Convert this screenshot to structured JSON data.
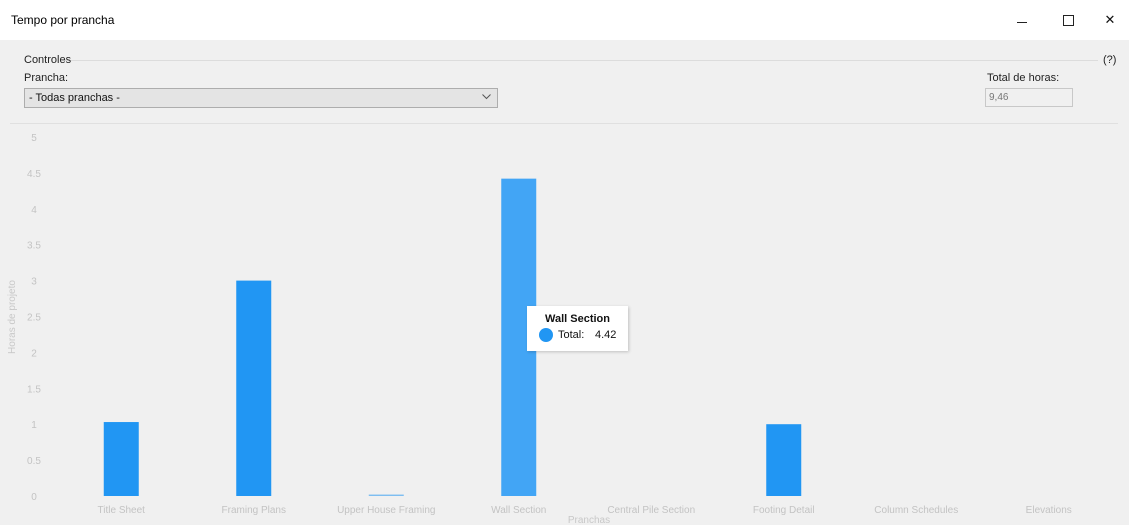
{
  "window": {
    "title": "Tempo por prancha",
    "buttons": {
      "minimize": "minimize",
      "maximize": "maximize",
      "close": "✕"
    }
  },
  "controls": {
    "legend": "Controles",
    "help": "(?)",
    "prancha_label": "Prancha:",
    "prancha_value": "- Todas pranchas -",
    "total_label": "Total de horas:",
    "total_value": "9,46"
  },
  "colors": {
    "bar": "#2196f3",
    "bar_highlight": "#42a5f5",
    "tooltip_dot": "#2196f3"
  },
  "tooltip": {
    "title": "Wall Section",
    "label": "Total:",
    "value": "4.42"
  },
  "chart_data": {
    "type": "bar",
    "categories": [
      "Title Sheet",
      "Framing Plans",
      "Upper House Framing",
      "Wall Section",
      "Central Pile Section",
      "Footing Detail",
      "Column Schedules",
      "Elevations"
    ],
    "series": [
      {
        "values": [
          1.03,
          3.0,
          0.02,
          4.42,
          0,
          1.0,
          0,
          0
        ]
      }
    ],
    "highlighted_index": 3,
    "xlabel": "Pranchas",
    "ylabel": "Horas de projeto",
    "ylim": [
      0,
      5
    ],
    "yticks": [
      "0",
      "0.5",
      "1",
      "1.5",
      "2",
      "2.5",
      "3",
      "3.5",
      "4",
      "4.5",
      "5"
    ],
    "grid": false,
    "legend": "none"
  }
}
